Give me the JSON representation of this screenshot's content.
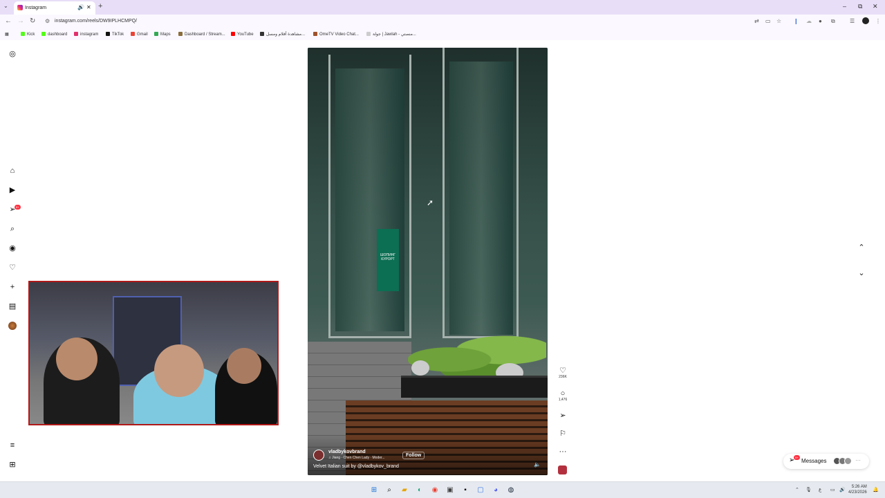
{
  "browser": {
    "tab": {
      "title": "Instagram",
      "speaker": "🔊",
      "close": "✕"
    },
    "new_tab": "+",
    "tab_menu": "⌄",
    "url": "instagram.com/reels/DW9IPLHCMPQ/",
    "window": {
      "minimize": "–",
      "restore": "⧉",
      "close": "✕"
    },
    "bookmarks": [
      {
        "label": "Kick",
        "color": "#53fc18"
      },
      {
        "label": "dashboard",
        "color": "#53fc18"
      },
      {
        "label": "instagram",
        "color": "#e1306c"
      },
      {
        "label": "TikTok",
        "color": "#111111"
      },
      {
        "label": "Gmail",
        "color": "#ea4335"
      },
      {
        "label": "Maps",
        "color": "#34a853"
      },
      {
        "label": "Dashboard / Stream...",
        "color": "#8a6d3b"
      },
      {
        "label": "YouTube",
        "color": "#ff0000"
      },
      {
        "label": "مشاهدة أفلام ومسل...",
        "color": "#333333"
      },
      {
        "label": "OmeTV Video Chat...",
        "color": "#a0522d"
      },
      {
        "label": "جولة | Jawlah - منصتي...",
        "color": "#cccccc"
      }
    ]
  },
  "sidebar": {
    "icons": [
      "instagram-logo-icon",
      "home-icon",
      "reels-icon",
      "messages-icon",
      "search-icon",
      "explore-icon",
      "heart-icon",
      "create-icon",
      "dashboard-icon",
      "profile-avatar",
      "more-menu-icon",
      "meta-apps-icon"
    ],
    "notification_badge": "9+"
  },
  "reel": {
    "username": "vladbykovbrand",
    "music": "♫ Jiang · Chen Chen Lady · Moder...",
    "follow": "Follow",
    "caption": "Velvet Italian suit by @vladbykov_brand",
    "sign_text": "ШОПИНГ КУРОРТ",
    "actions": {
      "likes": "236K",
      "comments": "1,476"
    }
  },
  "messages": {
    "label": "Messages",
    "badge": "9+",
    "more": "···"
  },
  "taskbar": {
    "time": "5:26 AM",
    "date": "4/23/2026"
  }
}
